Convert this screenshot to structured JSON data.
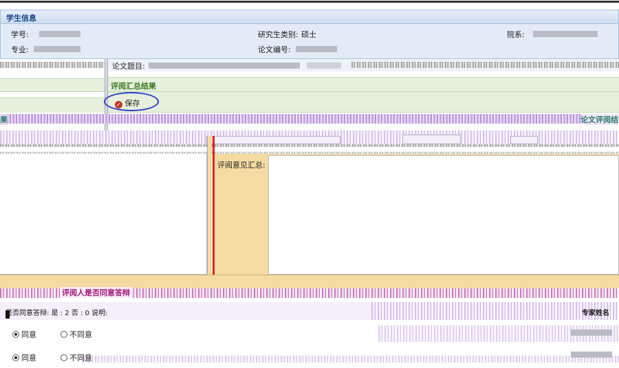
{
  "student_info": {
    "panel_title": "学生信息",
    "student_id_label": "学号:",
    "major_label": "专业:",
    "grad_type_label": "研究生类别:",
    "grad_type_value": "硕士",
    "thesis_no_label": "论文编号:",
    "department_label": "院系:"
  },
  "thesis_title_label": "论文题目:",
  "review_summary": {
    "section_title": "评阅汇总结果",
    "save_label": "保存",
    "left_fragment": "果",
    "right_fragment": "论文评阅结",
    "summary_label": "评阅意见汇总:"
  },
  "reviewer_section": {
    "title": "评阅人是否同意答辩",
    "agree_row_text": "是否同意答辩: 是 : 2 否 : 0 说明:",
    "expert_name_label": "专家姓名",
    "options": [
      "同意",
      "不同意"
    ],
    "rows": [
      {
        "selected": "同意"
      },
      {
        "selected": "同意"
      }
    ]
  },
  "colors": {
    "panel_header_bg": "#d6e4f5",
    "panel_body_bg": "#e3ebf7",
    "section_title_color": "#3d7a21",
    "save_circle": "#2b38c9",
    "summary_pane_bg": "#f5dba2",
    "reviewer_title_color": "#a0197d",
    "red_divider": "#e02020"
  },
  "icons": {
    "save": "save-icon"
  }
}
